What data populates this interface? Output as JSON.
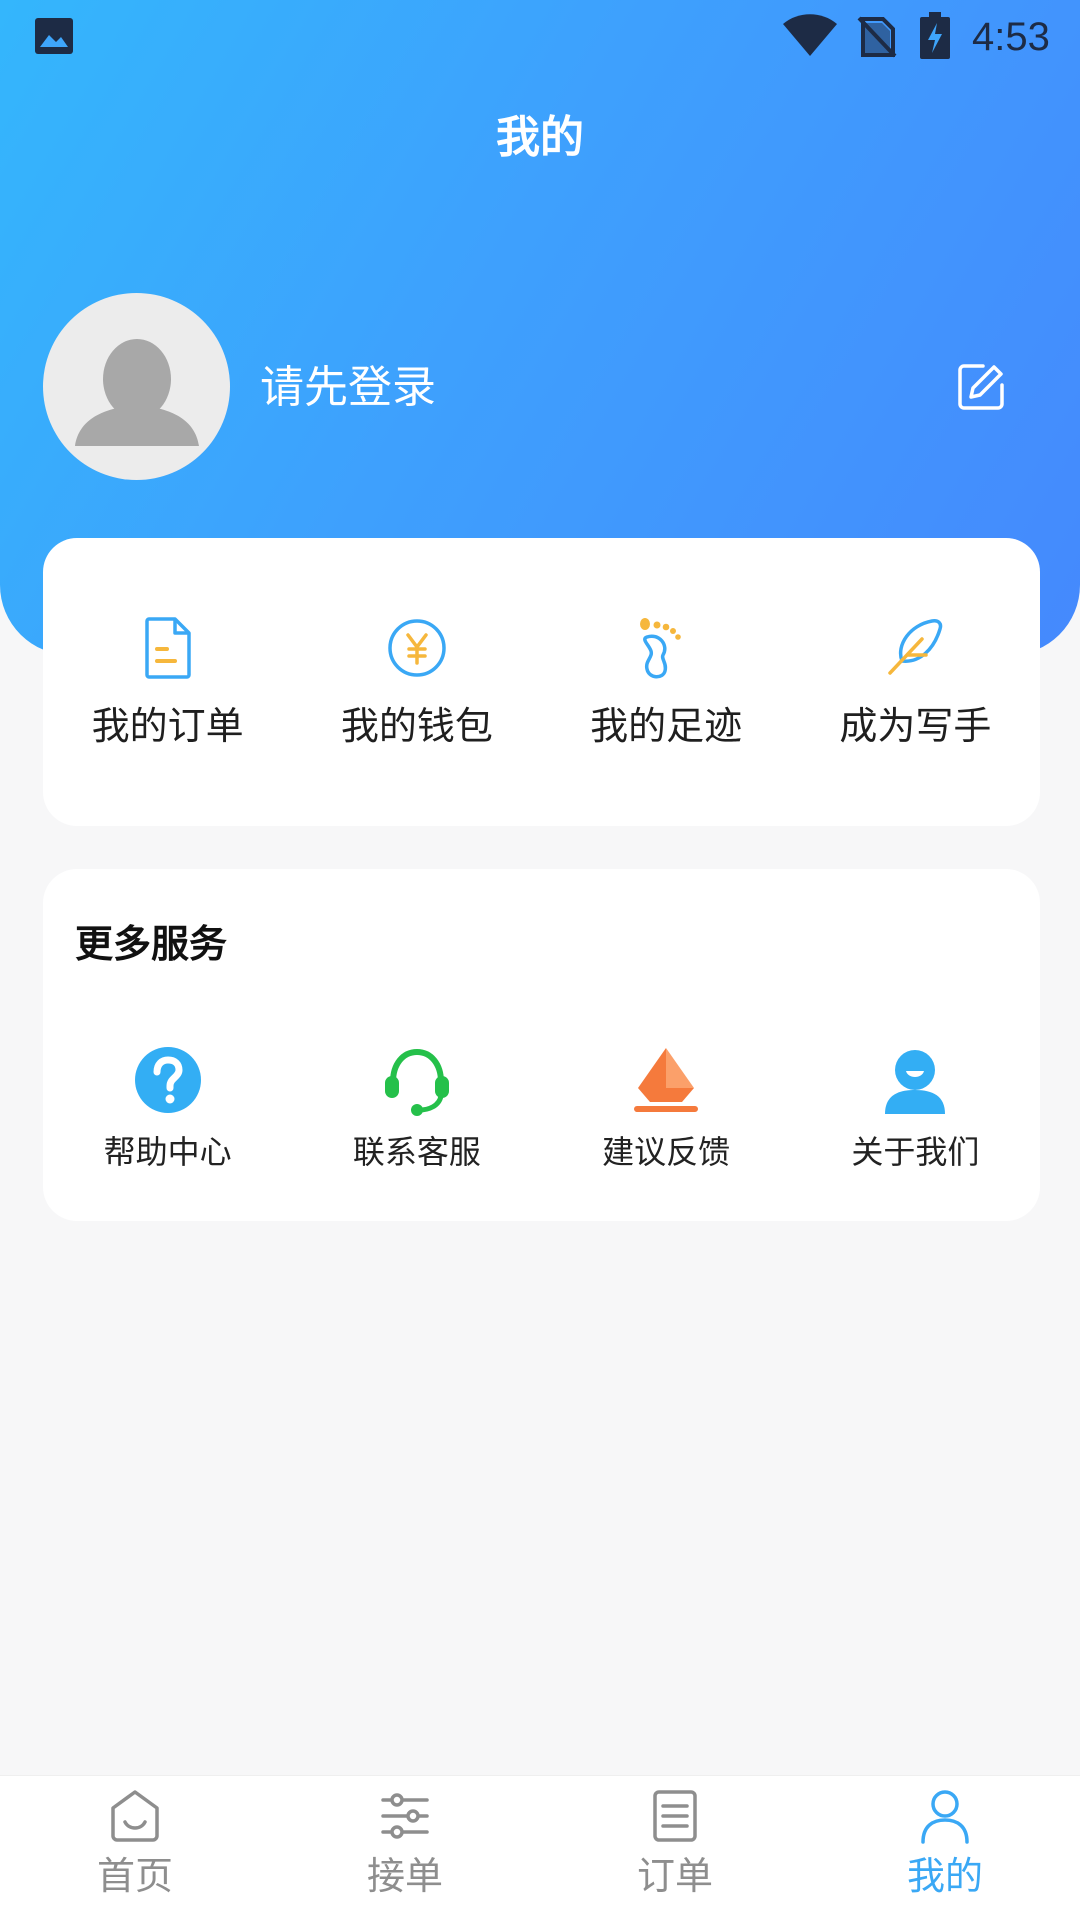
{
  "status_bar": {
    "time": "4:53"
  },
  "header": {
    "title": "我的"
  },
  "profile": {
    "login_prompt": "请先登录"
  },
  "quick_actions": [
    {
      "label": "我的订单",
      "icon": "order-doc-icon"
    },
    {
      "label": "我的钱包",
      "icon": "wallet-yen-icon"
    },
    {
      "label": "我的足迹",
      "icon": "footprint-icon"
    },
    {
      "label": "成为写手",
      "icon": "feather-pen-icon"
    }
  ],
  "more_services": {
    "title": "更多服务",
    "items": [
      {
        "label": "帮助中心",
        "icon": "help-question-icon"
      },
      {
        "label": "联系客服",
        "icon": "headset-icon"
      },
      {
        "label": "建议反馈",
        "icon": "feedback-sail-icon"
      },
      {
        "label": "关于我们",
        "icon": "about-person-icon"
      }
    ]
  },
  "bottom_nav": {
    "active": "我的",
    "items": [
      {
        "label": "首页",
        "icon": "home-icon"
      },
      {
        "label": "接单",
        "icon": "sliders-icon"
      },
      {
        "label": "订单",
        "icon": "list-doc-icon"
      },
      {
        "label": "我的",
        "icon": "person-icon"
      }
    ]
  },
  "colors": {
    "header_gradient_start": "#34b6fc",
    "header_gradient_end": "#4589fd",
    "nav_active": "#3aa8f5",
    "nav_inactive": "#8e8e8e"
  }
}
